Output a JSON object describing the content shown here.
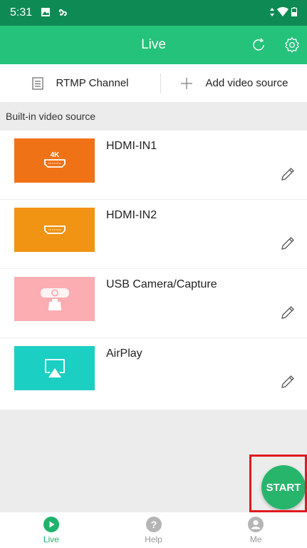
{
  "status_bar": {
    "time": "5:31"
  },
  "app_bar": {
    "title": "Live"
  },
  "toolbar": {
    "rtmp_label": "RTMP Channel",
    "add_label": "Add video source"
  },
  "section": {
    "label": "Built-in video source"
  },
  "sources": [
    {
      "name": "HDMI-IN1",
      "badge": "4K",
      "color": "#f07217",
      "icon": "hdmi-icon"
    },
    {
      "name": "HDMI-IN2",
      "badge": "",
      "color": "#f19313",
      "icon": "hdmi-icon"
    },
    {
      "name": "USB Camera/Capture",
      "badge": "",
      "color": "#fcadb2",
      "icon": "webcam-icon"
    },
    {
      "name": "AirPlay",
      "badge": "",
      "color": "#1ccfc3",
      "icon": "airplay-icon"
    }
  ],
  "start_button": {
    "label": "START",
    "color": "#27b56c"
  },
  "bottom_nav": {
    "items": [
      {
        "label": "Live",
        "icon": "play-circle-icon",
        "active": true
      },
      {
        "label": "Help",
        "icon": "help-circle-icon",
        "active": false
      },
      {
        "label": "Me",
        "icon": "person-circle-icon",
        "active": false
      }
    ]
  },
  "colors": {
    "header": "#24c27a",
    "status_bar": "#0e8a55",
    "accent": "#1fb36d",
    "highlight": "#e0191f"
  }
}
